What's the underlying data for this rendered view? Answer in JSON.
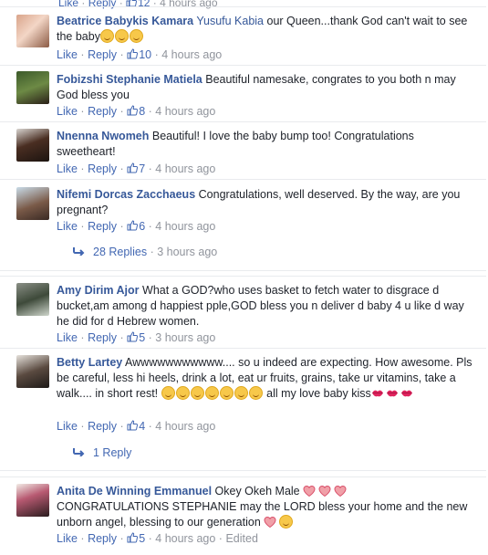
{
  "top_cutoff": {
    "like": "Like",
    "dot": "·",
    "reply": "Reply",
    "count": "12",
    "time": "4 hours ago"
  },
  "comments": [
    {
      "author": "Beatrice Babykis Kamara",
      "mention": "Yusufu Kabia",
      "text": " our Queen...thank God can't wait to see the baby",
      "like": "Like",
      "dot": "·",
      "reply": "Reply",
      "likes": "10",
      "time": "4 hours ago"
    },
    {
      "author": "Fobizshi Stephanie Matiela",
      "text": "Beautiful namesake, congrates to you both n may God bless you",
      "like": "Like",
      "dot": "·",
      "reply": "Reply",
      "likes": "8",
      "time": "4 hours ago"
    },
    {
      "author": "Nnenna Nwomeh",
      "text": "Beautiful! I love the baby bump too! Congratulations sweetheart!",
      "like": "Like",
      "dot": "·",
      "reply": "Reply",
      "likes": "7",
      "time": "4 hours ago"
    },
    {
      "author": "Nifemi Dorcas Zacchaeus",
      "text": "Congratulations, well deserved. By the way, are you pregnant?",
      "like": "Like",
      "dot": "·",
      "reply": "Reply",
      "likes": "6",
      "time": "4 hours ago",
      "replies": "28 Replies",
      "replies_time": "3 hours ago"
    },
    {
      "author": "Amy Dirim Ajor",
      "text": "What a GOD?who uses basket to fetch water to disgrace d bucket,am among d happiest pple,GOD bless you n deliver d baby 4 u like d way he did for d Hebrew women.",
      "like": "Like",
      "dot": "·",
      "reply": "Reply",
      "likes": "5",
      "time": "3 hours ago"
    },
    {
      "author": "Betty Lartey",
      "text": "Awwwwwwwwwww.... so u indeed are expecting. How awesome. Pls be careful, less hi heels, drink a lot, eat ur fruits, grains, take ur vitamins, take a walk.... in short rest!",
      "text2": " all my love baby kiss",
      "like": "Like",
      "dot": "·",
      "reply": "Reply",
      "likes": "4",
      "time": "4 hours ago",
      "replies": "1 Reply"
    },
    {
      "author": "Anita De Winning Emmanuel",
      "text": "Okey Okeh Male",
      "text2": "CONGRATULATIONS STEPHANIE may the LORD bless your home and the new unborn angel, blessing to our generation",
      "like": "Like",
      "dot": "·",
      "reply": "Reply",
      "likes": "5",
      "time": "4 hours ago",
      "edited": "Edited"
    }
  ],
  "colors": {
    "link": "#365899",
    "meta": "#90949c",
    "action": "#4267b2"
  },
  "icons": [
    "thumbs-up-icon",
    "reply-arrow-icon",
    "grinning-emoji-icon",
    "kiss-lips-icon",
    "heart-icon",
    "smiley-emoji-icon"
  ]
}
